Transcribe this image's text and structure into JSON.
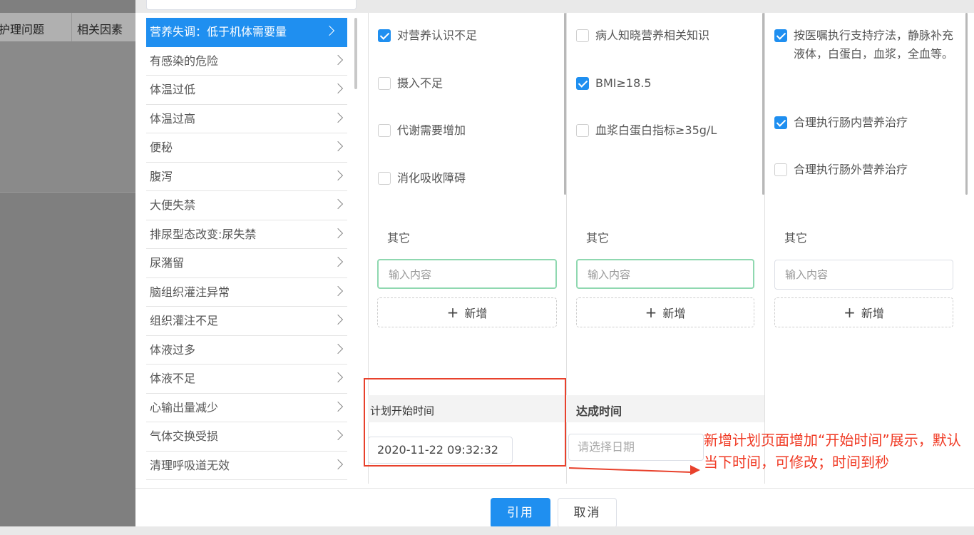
{
  "background": {
    "header_col1": "护理问题",
    "header_col2": "相关因素"
  },
  "diagnoses": [
    {
      "label": "营养失调：低于机体需要量",
      "active": true
    },
    {
      "label": "有感染的危险"
    },
    {
      "label": "体温过低"
    },
    {
      "label": "体温过高"
    },
    {
      "label": "便秘"
    },
    {
      "label": "腹泻"
    },
    {
      "label": "大便失禁"
    },
    {
      "label": "排尿型态改变:尿失禁"
    },
    {
      "label": "尿潴留"
    },
    {
      "label": "脑组织灌注异常"
    },
    {
      "label": "组织灌注不足"
    },
    {
      "label": "体液过多"
    },
    {
      "label": "体液不足"
    },
    {
      "label": "心输出量减少"
    },
    {
      "label": "气体交换受损"
    },
    {
      "label": "清理呼吸道无效"
    }
  ],
  "factors": {
    "items": [
      {
        "label": "对营养认识不足",
        "checked": true
      },
      {
        "label": "摄入不足",
        "checked": false
      },
      {
        "label": "代谢需要增加",
        "checked": false
      },
      {
        "label": "消化吸收障碍",
        "checked": false
      }
    ],
    "other_label": "其它",
    "input_placeholder": "输入内容",
    "add_label": "新增"
  },
  "goals": {
    "items": [
      {
        "label": "病人知晓营养相关知识",
        "checked": false
      },
      {
        "label": "BMI≥18.5",
        "checked": true
      },
      {
        "label": "血浆白蛋白指标≥35g/L",
        "checked": false
      }
    ],
    "other_label": "其它",
    "input_placeholder": "输入内容",
    "add_label": "新增"
  },
  "measures": {
    "items": [
      {
        "label": "按医嘱执行支持疗法，静脉补充液体，白蛋白，血浆，全血等。",
        "checked": true
      },
      {
        "label": "合理执行肠内营养治疗",
        "checked": true
      },
      {
        "label": "合理执行肠外营养治疗",
        "checked": false
      }
    ],
    "other_label": "其它",
    "input_placeholder": "输入内容",
    "add_label": "新增"
  },
  "plan_time": {
    "title": "计划开始时间",
    "value": "2020-11-22 09:32:32"
  },
  "achieve_time": {
    "title": "达成时间",
    "placeholder": "请选择日期"
  },
  "annotation": {
    "text": "新增计划页面增加“开始时间”展示，默认当下时间，可修改；时间到秒"
  },
  "footer": {
    "confirm_label": "引用",
    "cancel_label": "取消"
  },
  "colors": {
    "primary": "#1f8ff0",
    "annotation_red": "#e8412c",
    "focus_green": "#8fd8b0"
  }
}
